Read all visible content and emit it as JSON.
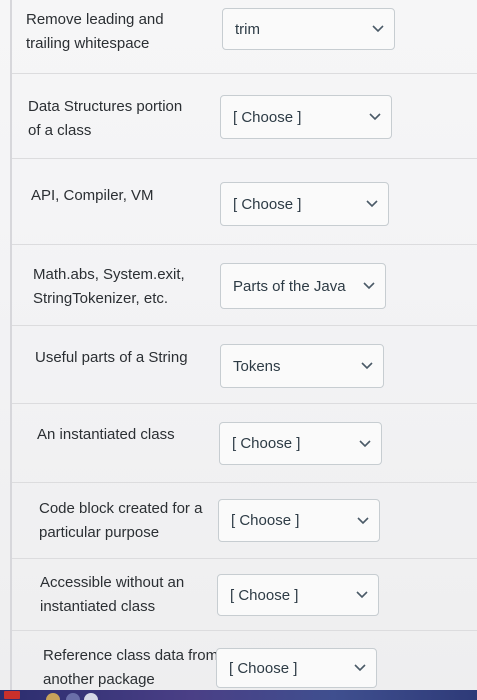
{
  "questions": [
    {
      "prompt": "Remove leading and\ntrailing whitespace",
      "selected": "trim"
    },
    {
      "prompt": "Data Structures portion\nof a class",
      "selected": "[ Choose ]"
    },
    {
      "prompt": "API, Compiler, VM",
      "selected": "[ Choose ]"
    },
    {
      "prompt": "Math.abs, System.exit,\nStringTokenizer, etc.",
      "selected": "Parts of the Java"
    },
    {
      "prompt": "Useful parts of a String",
      "selected": "Tokens"
    },
    {
      "prompt": "An instantiated class",
      "selected": "[ Choose ]"
    },
    {
      "prompt": "Code block created for a\nparticular purpose",
      "selected": "[ Choose ]"
    },
    {
      "prompt": "Accessible without an\ninstantiated class",
      "selected": "[ Choose ]"
    },
    {
      "prompt": "Reference class data from\nanother package",
      "selected": "[ Choose ]"
    }
  ],
  "icons": {
    "dropdown": "chevron-down-icon"
  },
  "colors": {
    "text": "#2b2f33",
    "border": "#c7cdd1",
    "divider": "#dcdcde"
  }
}
